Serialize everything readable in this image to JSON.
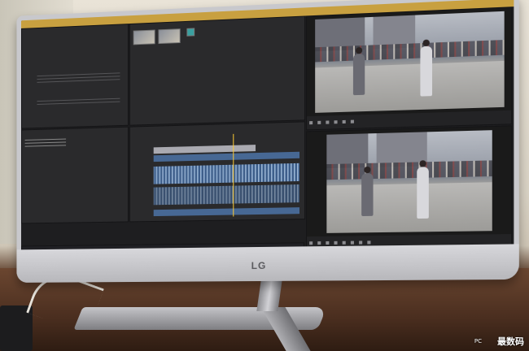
{
  "monitor": {
    "brand_logo": "LG"
  },
  "editor": {
    "panels": {
      "effects": "",
      "project": "",
      "source_monitor": "",
      "program_monitor": "",
      "timeline": ""
    }
  },
  "watermark": {
    "text": "最数码",
    "small_text": "PC"
  }
}
